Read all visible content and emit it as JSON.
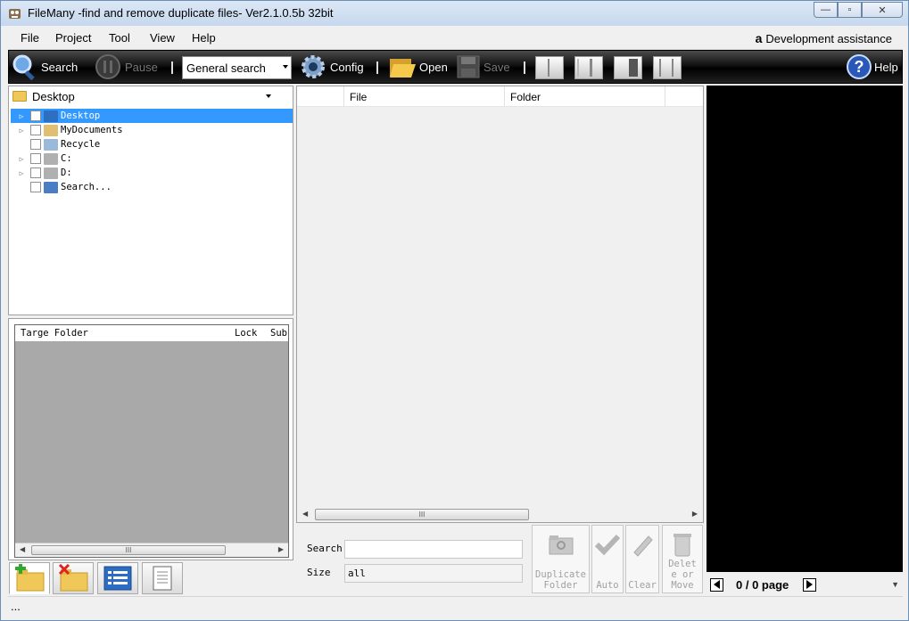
{
  "window": {
    "title": "FileMany -find and remove duplicate files- Ver2.1.0.5b 32bit",
    "minimize": "—",
    "maximize": "▫",
    "close": "✕"
  },
  "menu": {
    "items": [
      "File",
      "Project",
      "Tool",
      "View",
      "Help"
    ],
    "dev_assist": "Development assistance",
    "amazon_glyph": "a"
  },
  "toolbar": {
    "search": "Search",
    "pause": "Pause",
    "mode": "General search",
    "config": "Config",
    "open": "Open",
    "save": "Save",
    "help": "Help"
  },
  "tree": {
    "location": "Desktop",
    "nodes": [
      {
        "label": "Desktop",
        "selected": true,
        "expandable": true,
        "icon": "desktop-icon"
      },
      {
        "label": "MyDocuments",
        "selected": false,
        "expandable": true,
        "icon": "documents-icon"
      },
      {
        "label": "Recycle",
        "selected": false,
        "expandable": false,
        "icon": "recycle-icon"
      },
      {
        "label": "C:",
        "selected": false,
        "expandable": true,
        "icon": "drive-icon"
      },
      {
        "label": "D:",
        "selected": false,
        "expandable": true,
        "icon": "drive-icon"
      },
      {
        "label": "Search...",
        "selected": false,
        "expandable": false,
        "icon": "computer-icon"
      }
    ]
  },
  "target": {
    "col_folder": "Targe Folder",
    "col_lock": "Lock",
    "col_sub": "Sub"
  },
  "filelist": {
    "col_file": "File",
    "col_folder": "Folder",
    "scroll_grip": "III"
  },
  "filters": {
    "search_label": "Search",
    "search_value": "",
    "size_label": "Size",
    "size_value": "all"
  },
  "actions": {
    "duplicate_folder": "Duplicate Folder",
    "auto": "Auto",
    "clear": "Clear",
    "delete_move": "Delete or Move"
  },
  "pager": {
    "text": "0 / 0 page"
  },
  "status": {
    "text": "..."
  },
  "colors": {
    "selection": "#3399ff",
    "toolbar_bg": "#000000",
    "preview_bg": "#000000"
  }
}
